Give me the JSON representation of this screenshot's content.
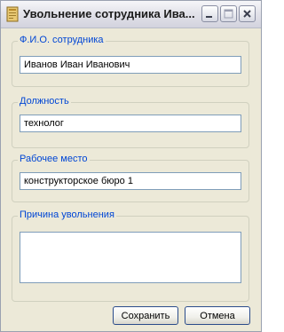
{
  "window": {
    "title": "Увольнение сотрудника Ива..."
  },
  "form": {
    "employee": {
      "label": "Ф.И.О. сотрудника",
      "value": "Иванов Иван Иванович"
    },
    "position": {
      "label": "Должность",
      "value": "технолог"
    },
    "workplace": {
      "label": "Рабочее место",
      "value": "конструкторское бюро 1"
    },
    "reason": {
      "label": "Причина увольнения",
      "value": ""
    }
  },
  "buttons": {
    "save": "Сохранить",
    "cancel": "Отмена"
  }
}
